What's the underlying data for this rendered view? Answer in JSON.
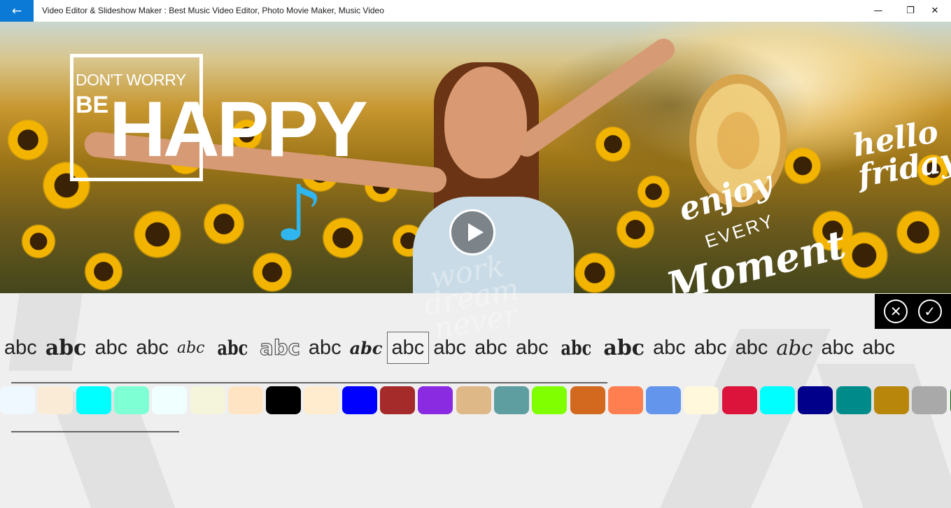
{
  "titlebar": {
    "back_icon": "←",
    "title": "Video Editor & Slideshow Maker : Best Music Video Editor, Photo Movie Maker, Music Video",
    "minimize_icon": "—",
    "maximize_icon": "❐",
    "close_icon": "✕"
  },
  "preview": {
    "sticker_small": "DON'T WORRY",
    "sticker_be": "BE",
    "sticker_happy": "HAPPY",
    "note_icon": "♪",
    "hello_friday": "hello friday",
    "enjoy": "enjoy",
    "every": "EVERY",
    "moment": "Moment",
    "ghost": "work dream never"
  },
  "actions": {
    "cancel_icon": "✕",
    "confirm_icon": "✓"
  },
  "fonts": [
    "abc",
    "abc",
    "abc",
    "abc",
    "abc",
    "abc",
    "abc",
    "abc",
    "abc",
    "abc",
    "abc",
    "abc",
    "abc",
    "abc",
    "abc",
    "abc",
    "abc",
    "abc",
    "abc",
    "abc",
    "abc"
  ],
  "colors": [
    "#f0f8ff",
    "#faebd7",
    "#00ffff",
    "#7fffd4",
    "#f0ffff",
    "#f5f5dc",
    "#ffe4c4",
    "#000000",
    "#ffebcd",
    "#0000ff",
    "#a52a2a",
    "#8a2be2",
    "#deb887",
    "#5f9ea0",
    "#7fff00",
    "#d2691e",
    "#ff7f50",
    "#6495ed",
    "#fff8dc",
    "#dc143c",
    "#00ffff",
    "#00008b",
    "#008b8b",
    "#b8860b",
    "#a9a9a9",
    "#006400"
  ]
}
